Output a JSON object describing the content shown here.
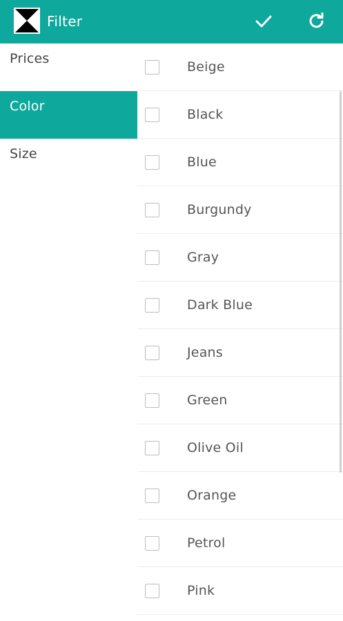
{
  "header": {
    "title": "Filter",
    "background_color": "#0fa89c",
    "close_icon": "close-icon",
    "apply_icon": "checkmark-icon",
    "refresh_icon": "refresh-icon"
  },
  "sidebar": {
    "items": [
      {
        "label": "Prices",
        "active": false
      },
      {
        "label": "Color",
        "active": true
      },
      {
        "label": "Size",
        "active": false
      }
    ]
  },
  "color_filter": {
    "options": [
      {
        "label": "Beige",
        "checked": false
      },
      {
        "label": "Black",
        "checked": false
      },
      {
        "label": "Blue",
        "checked": false
      },
      {
        "label": "Burgundy",
        "checked": false
      },
      {
        "label": "Gray",
        "checked": false
      },
      {
        "label": "Dark Blue",
        "checked": false
      },
      {
        "label": "Jeans",
        "checked": false
      },
      {
        "label": "Green",
        "checked": false
      },
      {
        "label": "Olive Oil",
        "checked": false
      },
      {
        "label": "Orange",
        "checked": false
      },
      {
        "label": "Petrol",
        "checked": false
      },
      {
        "label": "Pink",
        "checked": false
      }
    ]
  }
}
